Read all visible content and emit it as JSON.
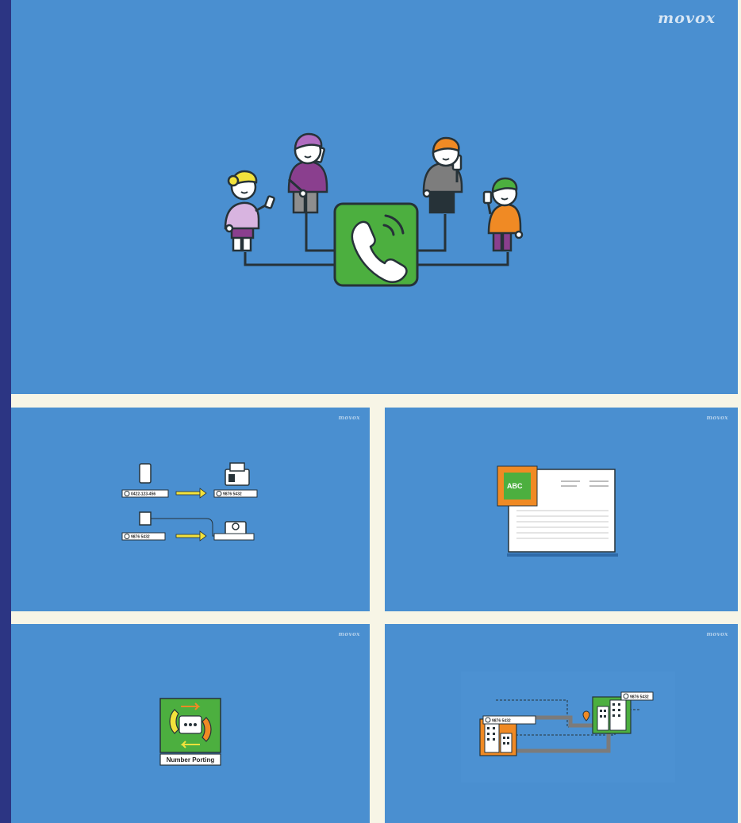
{
  "brand": {
    "logo": "movox"
  },
  "hero": {
    "scene": "conference-call-illustration"
  },
  "panel_numbers": {
    "mobile_number": "0422-123-456",
    "desk_number": "9876 5432",
    "fax_number": "9876 5432"
  },
  "panel_invoice": {
    "logo_text": "ABC"
  },
  "panel_porting": {
    "caption": "Number Porting"
  },
  "panel_offices": {
    "office_a_number": "9876 5432",
    "office_b_number": "9876 5432"
  },
  "colors": {
    "background": "#4a8fd0",
    "accent_green": "#4caf3f",
    "accent_orange": "#f08a24",
    "accent_purple": "#8a3f8e",
    "accent_yellow": "#f2e23c",
    "separator": "#f7f5e6",
    "side_bar": "#2c3583"
  }
}
